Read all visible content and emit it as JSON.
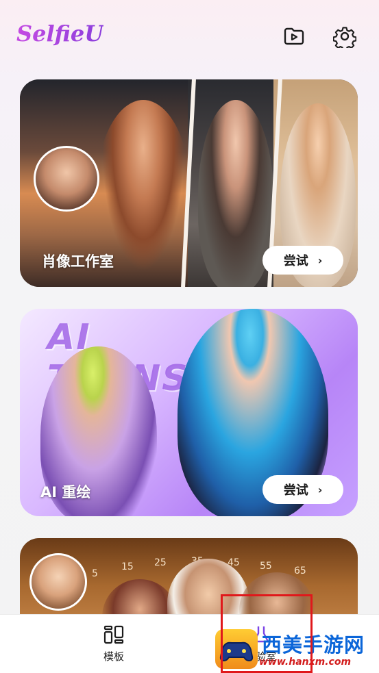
{
  "app": {
    "logo": "SelfieU"
  },
  "header": {
    "gallery_icon": "video-folder-icon",
    "settings_icon": "gear-icon"
  },
  "cards": [
    {
      "title": "肖像工作室",
      "button": "尝试",
      "chevron": "›"
    },
    {
      "title": "AI 重绘",
      "button": "尝试",
      "chevron": "›",
      "banner_text": "AI TRANSFORM"
    },
    {
      "dial_numbers": [
        "5",
        "15",
        "25",
        "35",
        "45",
        "55",
        "65"
      ]
    }
  ],
  "tabbar": {
    "tabs": [
      {
        "label": "模板",
        "icon": "templates-icon"
      },
      {
        "label": "实验室",
        "icon": "lab-icon"
      }
    ]
  },
  "watermark": {
    "title": "西美手游网",
    "url": "www.hanxm.com"
  },
  "colors": {
    "accent": "#b23fd6",
    "highlight": "#e0181b"
  }
}
